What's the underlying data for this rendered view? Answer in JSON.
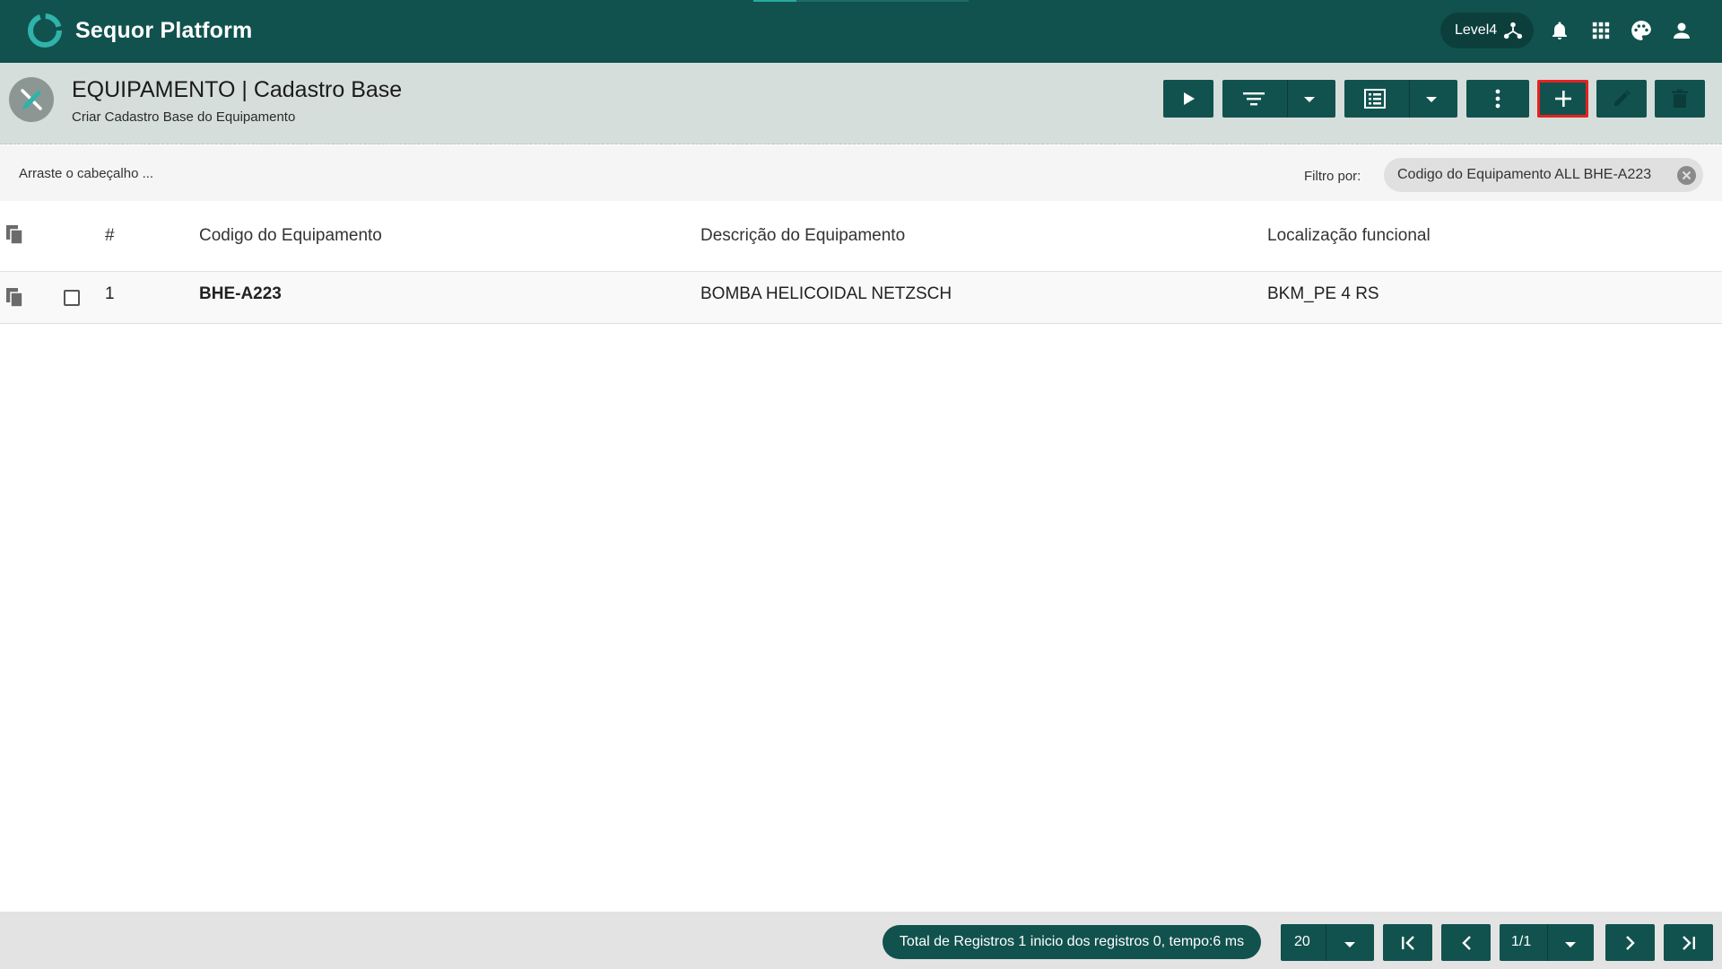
{
  "app": {
    "brand": "Sequor Platform",
    "level": "Level4",
    "icons": [
      "logo-ring-icon",
      "hierarchy-icon",
      "bell-icon",
      "apps-grid-icon",
      "palette-icon",
      "user-icon"
    ]
  },
  "colors": {
    "primary": "#11524e",
    "header_bg": "#d6dedb",
    "highlight": "#e52222"
  },
  "page": {
    "title": "EQUIPAMENTO | Cadastro Base",
    "subtitle": "Criar Cadastro Base do Equipamento",
    "avatar_icon": "wrench-screwdriver-icon"
  },
  "toolbar": {
    "buttons": [
      "play-icon",
      "filter-icon",
      "caret-down-icon",
      "list-view-icon",
      "caret-down-icon",
      "more-vert-icon",
      "plus-icon",
      "pencil-icon",
      "trash-icon"
    ],
    "selected": "plus-icon"
  },
  "groupbar": {
    "hint": "Arraste o cabeçalho ...",
    "filter_label": "Filtro por:",
    "filter_chip": "Codigo do Equipamento ALL BHE-A223"
  },
  "table": {
    "columns": [
      "#",
      "Codigo do Equipamento",
      "Descrição do Equipamento",
      "Localização funcional"
    ],
    "rows": [
      {
        "index": "1",
        "code": "BHE-A223",
        "description": "BOMBA HELICOIDAL NETZSCH",
        "location": "BKM_PE 4 RS",
        "checked": false
      }
    ]
  },
  "footer": {
    "status": "Total de Registros 1 inicio dos registros 0, tempo:6 ms",
    "page_size": "20",
    "page": "1/1"
  }
}
